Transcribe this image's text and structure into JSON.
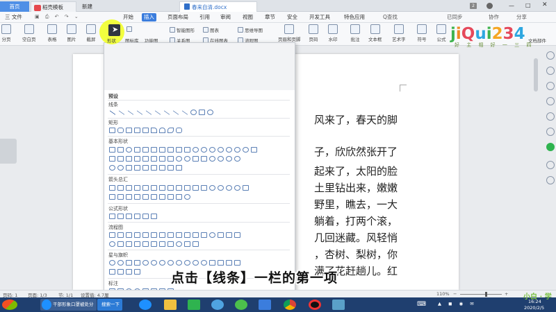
{
  "tabs": {
    "home": "首页",
    "daoke": "稻壳模板",
    "new": "新建",
    "doc": "春来自清.docx"
  },
  "menubar": {
    "file": "三 文件",
    "items": [
      "开始",
      "插入",
      "页面布局",
      "引用",
      "审阅",
      "视图",
      "章节",
      "安全",
      "开发工具",
      "特色应用"
    ],
    "active_index": 1,
    "search": "Q查找",
    "sync": "已同步",
    "share": "协作",
    "share2": "分享"
  },
  "ribbon": {
    "big": [
      "分页",
      "空白页",
      "表格",
      "图片",
      "截屏",
      "形状"
    ],
    "small1": [
      "图标库",
      "功能图"
    ],
    "small2": [
      "智能图形",
      "关系图"
    ],
    "small3": [
      "图表",
      "在线图表"
    ],
    "small4": [
      "思维导图",
      "流程图"
    ],
    "right": [
      "页眉和页脚",
      "页码",
      "水印",
      "批注",
      "文本框",
      "艺术字",
      "符号",
      "公式"
    ],
    "right_small": [
      "首字下沉",
      "插入数字",
      "对象",
      "日期",
      "附件",
      "文档部件"
    ]
  },
  "dropdown": {
    "header": "预设",
    "sections": [
      "线条",
      "矩形",
      "基本形状",
      "箭头总汇",
      "公式形状",
      "流程图",
      "星与旗帜",
      "标注"
    ]
  },
  "document": {
    "lines": [
      "风来了，春天的脚",
      "子，欣欣然张开了",
      "起来了，太阳的脸",
      "土里钻出来，嫩嫩",
      "野里，瞧去，一大",
      "躺着，打两个滚，",
      "几回迷藏。风轻悄",
      "，杏树、梨树，你",
      "满了花赶趟儿。红"
    ]
  },
  "statusbar": {
    "page": "页码: 1",
    "pages": "页面: 1/3",
    "section": "节: 1/1",
    "setting": "设置值: 4.7厘",
    "zoom": "110%"
  },
  "taskbar": {
    "start_btn": "干部形象口罩被处分",
    "search": "搜索一下",
    "time": "16:24",
    "date": "2020/2/5"
  },
  "subtitle": "点击【线条】一栏的第一项",
  "watermark": {
    "logo": "jiQui234",
    "logo_sub": "好 主 相 好 一 三 四",
    "bottom_right": "小白 · 学"
  }
}
